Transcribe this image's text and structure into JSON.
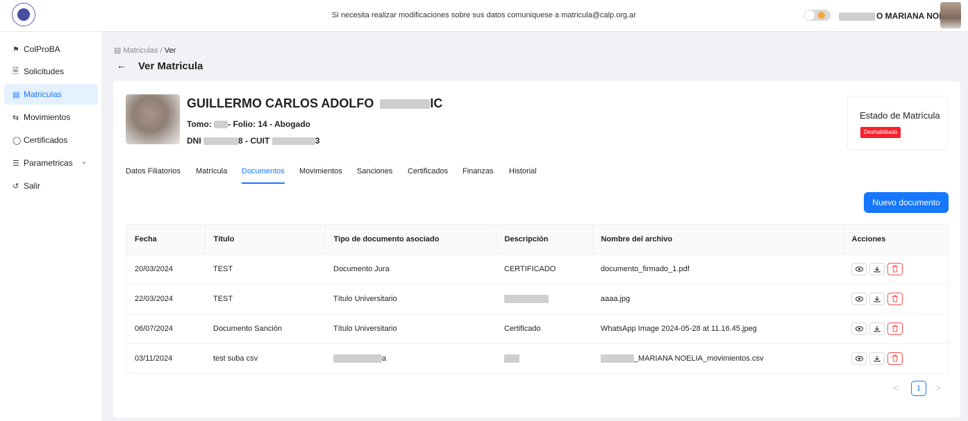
{
  "topbar": {
    "notice": "Si necesita realizar modificaciones sobre sus datos comuniquese a matricula@calp.org.ar",
    "user_name": "O MARIANA NOELIA"
  },
  "sidebar": {
    "items": [
      {
        "label": "ColProBA",
        "icon": "colproba-icon"
      },
      {
        "label": "Solicitudes",
        "icon": "file-icon"
      },
      {
        "label": "Matriculas",
        "icon": "id-card-icon"
      },
      {
        "label": "Movimientos",
        "icon": "swap-icon"
      },
      {
        "label": "Certificados",
        "icon": "shield-icon"
      },
      {
        "label": "Parametricas",
        "icon": "list-icon"
      },
      {
        "label": "Salir",
        "icon": "logout-icon"
      }
    ],
    "active": "Matriculas"
  },
  "breadcrumb": {
    "parent": "Matriculas",
    "separator": "/",
    "current": "Ver"
  },
  "page_title": "Ver Matricula",
  "profile": {
    "name": "GUILLERMO CARLOS ADOLFO",
    "name_suffix": "IC",
    "tomo_label": "Tomo:",
    "folio_text": "- Folio: 14 - Abogado",
    "dni_label": "DNI",
    "dni_suffix": "8 - CUIT",
    "cuit_suffix": "3"
  },
  "status": {
    "title": "Estado de Matrícula",
    "badge": "Deshabilitado"
  },
  "tabs": [
    "Datos Filiatorios",
    "Matrícula",
    "Documentos",
    "Movimientos",
    "Sanciones",
    "Certificados",
    "Finanzas",
    "Historial"
  ],
  "active_tab": "Documentos",
  "new_button": "Nuevo documento",
  "table": {
    "headers": [
      "Fecha",
      "Título",
      "Tipo de documento asociado",
      "Descripción",
      "Nombre del archivo",
      "Acciones"
    ],
    "rows": [
      {
        "fecha": "20/03/2024",
        "titulo": "TEST",
        "tipo": "Documento Jura",
        "descripcion": "CERTIFICADO",
        "archivo": "documento_firmado_1.pdf"
      },
      {
        "fecha": "22/03/2024",
        "titulo": "TEST",
        "tipo": "Título Universitario",
        "descripcion": "",
        "archivo": "aaaa.jpg"
      },
      {
        "fecha": "06/07/2024",
        "titulo": "Documento Sanción",
        "tipo": "Título Universitario",
        "descripcion": "Certificado",
        "archivo": "WhatsApp Image 2024-05-28 at 11.16.45.jpeg"
      },
      {
        "fecha": "03/11/2024",
        "titulo": "test suba csv",
        "tipo": "a",
        "descripcion": "",
        "archivo": "_MARIANA NOELIA_movimientos.csv"
      }
    ]
  },
  "pagination": {
    "current": "1",
    "prev": "<",
    "next": ">"
  },
  "colors": {
    "primary": "#1677ff",
    "danger": "#f5222d",
    "active_bg": "#e6f1ff"
  }
}
